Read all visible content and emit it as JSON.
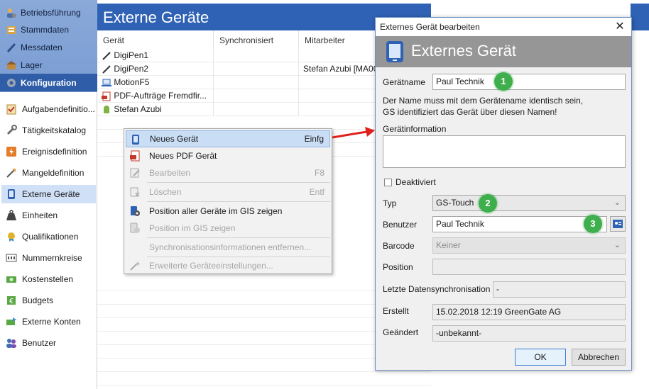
{
  "sidebar": {
    "top_items": [
      {
        "label": "Betriebsführung",
        "icon": "person-gear-icon"
      },
      {
        "label": "Stammdaten",
        "icon": "database-icon"
      },
      {
        "label": "Messdaten",
        "icon": "pen-icon"
      },
      {
        "label": "Lager",
        "icon": "warehouse-icon"
      },
      {
        "label": "Konfiguration",
        "icon": "gear-icon"
      }
    ],
    "items": [
      {
        "label": "Aufgabendefinitio...",
        "icon": "checklist-icon"
      },
      {
        "label": "Tätigkeitskatalog",
        "icon": "wrench-icon"
      },
      {
        "label": "Ereignisdefinition",
        "icon": "lightning-icon"
      },
      {
        "label": "Mangeldefinition",
        "icon": "tools-icon"
      },
      {
        "label": "Externe Geräte",
        "icon": "mobile-device-icon"
      },
      {
        "label": "Einheiten",
        "icon": "weight-icon"
      },
      {
        "label": "Qualifikationen",
        "icon": "certificate-icon"
      },
      {
        "label": "Nummernkreise",
        "icon": "number-range-icon"
      },
      {
        "label": "Kostenstellen",
        "icon": "money-icon"
      },
      {
        "label": "Budgets",
        "icon": "budget-icon"
      },
      {
        "label": "Externe Konten",
        "icon": "transfer-icon"
      },
      {
        "label": "Benutzer",
        "icon": "users-icon"
      }
    ]
  },
  "main": {
    "title": "Externe Geräte",
    "columns": [
      "Gerät",
      "Synchronisiert",
      "Mitarbeiter"
    ],
    "rows": [
      {
        "name": "DigiPen1",
        "sync": "",
        "employee": "",
        "icon": "digipen-icon"
      },
      {
        "name": "DigiPen2",
        "sync": "",
        "employee": "Stefan Azubi [MA00",
        "icon": "digipen-icon"
      },
      {
        "name": "MotionF5",
        "sync": "",
        "employee": "",
        "icon": "laptop-icon"
      },
      {
        "name": "PDF-Aufträge Fremdfir...",
        "sync": "",
        "employee": "",
        "icon": "pdf-icon"
      },
      {
        "name": "Stefan Azubi",
        "sync": "",
        "employee": "",
        "icon": "android-icon"
      }
    ]
  },
  "context_menu": {
    "items": [
      {
        "label": "Neues Gerät",
        "shortcut": "Einfg",
        "icon": "mobile-device-icon",
        "disabled": false,
        "highlighted": true
      },
      {
        "label": "Neues PDF Gerät",
        "shortcut": "",
        "icon": "pdf-icon",
        "disabled": false,
        "highlighted": false
      },
      {
        "label": "Bearbeiten",
        "shortcut": "F8",
        "icon": "edit-icon",
        "disabled": true,
        "highlighted": false
      },
      {
        "label": "Löschen",
        "shortcut": "Entf",
        "icon": "delete-icon",
        "disabled": true,
        "highlighted": false
      },
      {
        "label": "Position aller Geräte im GIS zeigen",
        "shortcut": "",
        "icon": "gis-all-icon",
        "disabled": false,
        "highlighted": false
      },
      {
        "label": "Position im GIS zeigen",
        "shortcut": "",
        "icon": "gis-icon",
        "disabled": true,
        "highlighted": false
      },
      {
        "label": "Synchronisationsinformationen entfernen...",
        "shortcut": "",
        "icon": "",
        "disabled": true,
        "highlighted": false
      },
      {
        "label": "Erweiterte Geräteeinstellungen...",
        "shortcut": "",
        "icon": "settings-wand-icon",
        "disabled": true,
        "highlighted": false
      }
    ]
  },
  "dialog": {
    "window_title": "Externes Gerät bearbeiten",
    "banner_title": "Externes Gerät",
    "geraetname_label": "Gerätname",
    "geraetname_value": "Paul Technik",
    "hint_line1": "Der Name muss mit dem Gerätename identisch sein,",
    "hint_line2": "GS identifiziert das Gerät über diesen Namen!",
    "info_label": "Gerätinformation",
    "info_value": "",
    "deaktiviert_label": "Deaktiviert",
    "typ_label": "Typ",
    "typ_value": "GS-Touch",
    "benutzer_label": "Benutzer",
    "benutzer_value": "Paul Technik",
    "barcode_label": "Barcode",
    "barcode_value": "Keiner",
    "position_label": "Position",
    "position_value": "",
    "sync_label": "Letzte Datensynchronisation",
    "sync_value": "-",
    "erstellt_label": "Erstellt",
    "erstellt_value": "15.02.2018 12:19 GreenGate AG",
    "geaendert_label": "Geändert",
    "geaendert_value": "-unbekannt-",
    "ok_label": "OK",
    "cancel_label": "Abbrechen",
    "badges": [
      "1",
      "2",
      "3"
    ]
  },
  "colors": {
    "header_blue": "#2f62b5",
    "nav_active": "#2f5da8",
    "badge_green": "#3fae4c",
    "arrow_red": "#e0201b",
    "banner_gray": "#969696"
  }
}
